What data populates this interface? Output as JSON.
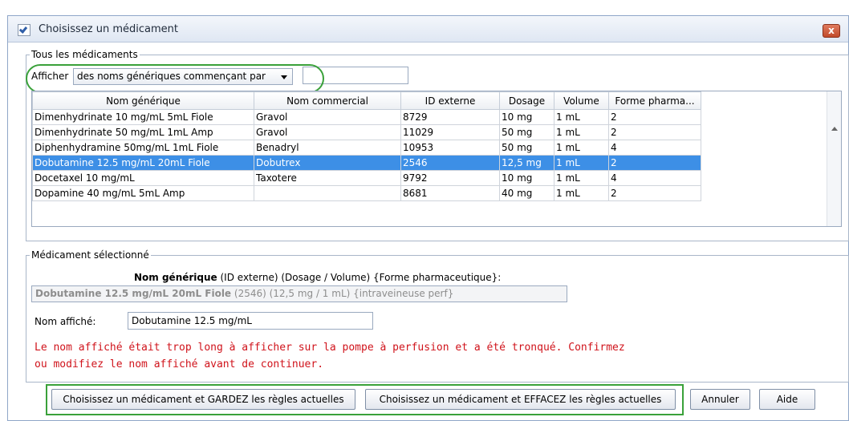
{
  "window": {
    "title": "Choisissez un médicament",
    "close_label": "x"
  },
  "all_meds": {
    "legend": "Tous les médicaments",
    "filter_label": "Afficher",
    "filter_selected": "des noms génériques commençant par",
    "filter_text": "",
    "columns": [
      "Nom générique",
      "Nom commercial",
      "ID externe",
      "Dosage",
      "Volume",
      "Forme pharma..."
    ],
    "rows": [
      [
        "Dimenhydrinate  10 mg/mL  5mL Fiole",
        "Gravol",
        "8729",
        "10 mg",
        "1 mL",
        "2"
      ],
      [
        "Dimenhydrinate  50 mg/mL  1mL Amp",
        "Gravol",
        "11029",
        "50 mg",
        "1 mL",
        "2"
      ],
      [
        "Diphenhydramine 50mg/mL 1mL Fiole",
        "Benadryl",
        "10953",
        "50 mg",
        "1 mL",
        "4"
      ],
      [
        "Dobutamine 12.5 mg/mL  20mL Fiole",
        "Dobutrex",
        "2546",
        "12,5 mg",
        "1 mL",
        "2"
      ],
      [
        "Docetaxel 10 mg/mL",
        "Taxotere",
        "9792",
        "10 mg",
        "1 mL",
        "4"
      ],
      [
        "Dopamine 40 mg/mL  5mL Amp",
        "",
        "8681",
        "40 mg",
        "1 mL",
        "2"
      ]
    ],
    "selected_row": 3
  },
  "selected_med": {
    "legend": "Médicament sélectionné",
    "heading_bold": "Nom générique",
    "heading_rest": " (ID externe) (Dosage / Volume) {Forme pharmaceutique}:",
    "full_bold": "Dobutamine 12.5 mg/mL 20mL Fiole",
    "full_rest": " (2546) (12,5 mg / 1 mL) {intraveineuse perf}",
    "display_label": "Nom affiché:",
    "display_value": "Dobutamine 12.5 mg/mL",
    "warning_line1": "Le nom affiché était trop long à afficher sur la pompe à perfusion et a été tronqué. Confirmez",
    "warning_line2": "ou modifiez le nom affiché avant de continuer."
  },
  "buttons": {
    "keep_rules": "Choisissez un médicament et GARDEZ les règles actuelles",
    "clear_rules": "Choisissez un médicament et EFFACEZ les règles actuelles",
    "cancel": "Annuler",
    "help": "Aide"
  },
  "colors": {
    "selection": "#3d8fe6",
    "warning": "#d0131b",
    "highlight": "#3aa13a"
  }
}
